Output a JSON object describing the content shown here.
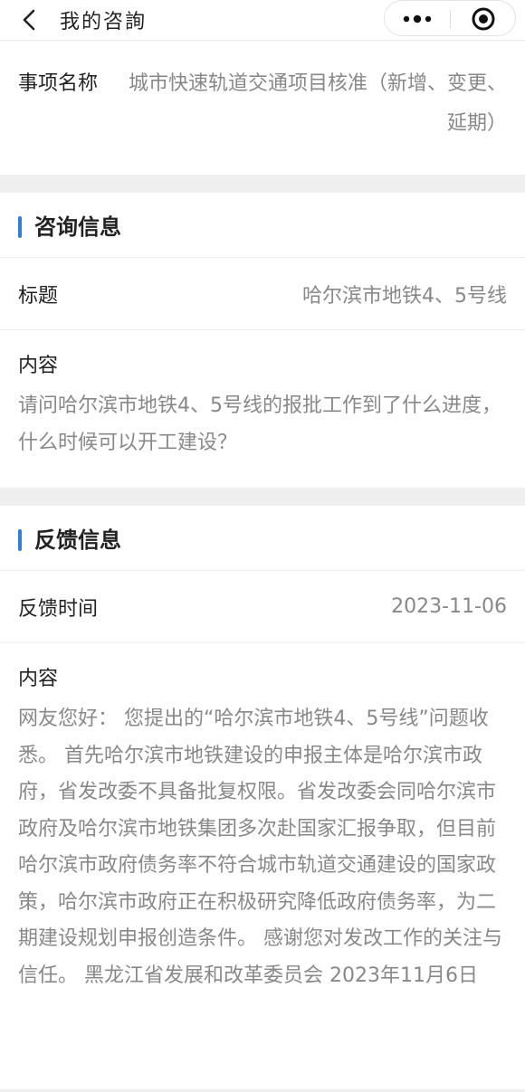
{
  "nav": {
    "title": "我的咨詢"
  },
  "item": {
    "label": "事项名称",
    "value": "城市快速轨道交通项目核准（新增、变更、延期）"
  },
  "consult": {
    "section_title": "咨询信息",
    "title_label": "标题",
    "title_value": "哈尔滨市地铁4、5号线",
    "content_label": "内容",
    "content_text": "请问哈尔滨市地铁4、5号线的报批工作到了什么进度，什么时候可以开工建设？"
  },
  "feedback": {
    "section_title": "反馈信息",
    "time_label": "反馈时间",
    "time_value": "2023-11-06",
    "content_label": "内容",
    "content_text": "网友您好： 您提出的“哈尔滨市地铁4、5号线”问题收悉。 首先哈尔滨市地铁建设的申报主体是哈尔滨市政府，省发改委不具备批复权限。省发改委会同哈尔滨市政府及哈尔滨市地铁集团多次赴国家汇报争取，但目前哈尔滨市政府债务率不符合城市轨道交通建设的国家政策，哈尔滨市政府正在积极研究降低政府债务率，为二期建设规划申报创造条件。 感谢您对发改工作的关注与信任。 黑龙江省发展和改革委员会 2023年11月6日"
  },
  "colors": {
    "accent": "#2f7ee6",
    "muted_text": "#888888",
    "page_bg": "#efefef"
  }
}
